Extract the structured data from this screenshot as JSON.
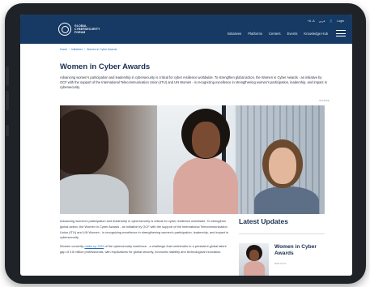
{
  "header": {
    "logo_text_line1": "GLOBAL",
    "logo_text_line2": "CYBERSECURITY",
    "logo_text_line3": "FORUM",
    "utility": {
      "language": "عربي",
      "login": "Login"
    },
    "nav": [
      {
        "label": "Initiatives"
      },
      {
        "label": "Platforms"
      },
      {
        "label": "Centers"
      },
      {
        "label": "Events"
      },
      {
        "label": "Knowledge Hub"
      }
    ]
  },
  "breadcrumb": {
    "home": "Home",
    "section": "Initiatives",
    "current": "Women in Cyber Awards"
  },
  "page": {
    "title": "Women in Cyber Awards",
    "intro": "Advancing women's participation and leadership in cybersecurity is critical for cyber resilience worldwide. To strengthen global action, the Women in Cyber Awards - an initiative by GCF with the support of the International Telecommunication Union (ITU) and UN Women - is recognizing excellence in strengthening women's participation, leadership, and impact in cybersecurity.",
    "source_tag": "SOURCE",
    "body_p1": "Advancing women's participation and leadership in cybersecurity is critical for cyber resilience worldwide. To strengthen global action, the Women in Cyber Awards - an initiative by GCF with the support of the International Telecommunication Union (ITU) and UN Women - is recognizing excellence in strengthening women's participation, leadership, and impact in cybersecurity.",
    "body_p2_pre": "Women currently",
    "body_p2_link": "make up 24%",
    "body_p2_post": "of the cybersecurity workforce - a challenge that contributes to a persistent global talent gap of 3.8 million professionals, with implications for global security, economic stability and technological innovation."
  },
  "sidebar": {
    "title": "Latest Updates",
    "updates": [
      {
        "title": "Women in Cyber Awards",
        "date": "2025-03-01"
      }
    ]
  },
  "colors": {
    "header_bg": "#173a64",
    "title": "#1a2f4f",
    "link": "#2a6fb8"
  },
  "icons": {
    "user": "user-icon",
    "menu": "hamburger-icon",
    "logo": "gcf-logo-icon"
  }
}
